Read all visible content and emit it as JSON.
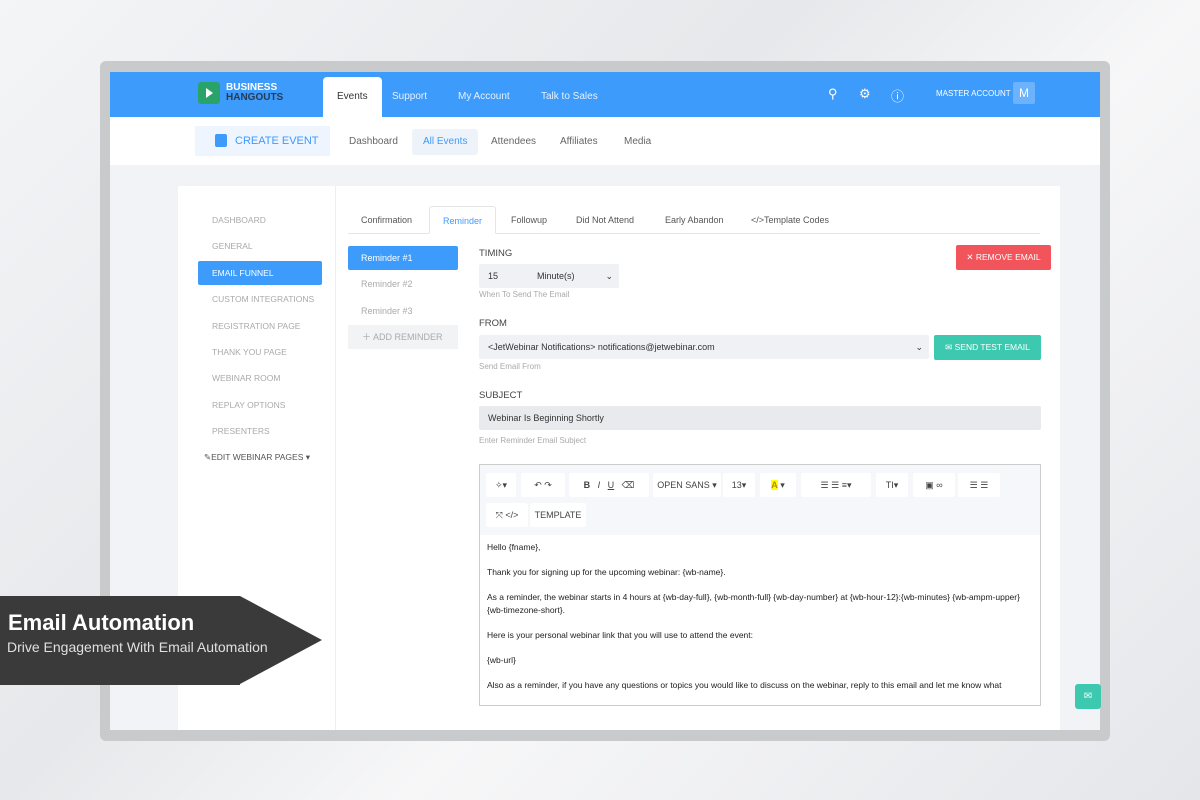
{
  "header": {
    "logo_line1": "BUSINESS",
    "logo_line2": "HANGOUTS",
    "tabs": [
      "Events",
      "Support",
      "My Account",
      "Talk to Sales"
    ],
    "account_label": "MASTER ACCOUNT",
    "avatar": "M"
  },
  "subnav": {
    "create_event": "CREATE EVENT",
    "items": [
      "Dashboard",
      "All Events",
      "Attendees",
      "Affiliates",
      "Media"
    ]
  },
  "sidebar": {
    "items": [
      "DASHBOARD",
      "GENERAL",
      "EMAIL FUNNEL",
      "CUSTOM INTEGRATIONS",
      "REGISTRATION PAGE",
      "THANK YOU PAGE",
      "WEBINAR ROOM",
      "REPLAY OPTIONS",
      "PRESENTERS",
      "EDIT WEBINAR PAGES"
    ]
  },
  "email_tabs": [
    "Confirmation",
    "Reminder",
    "Followup",
    "Did Not Attend",
    "Early Abandon",
    "</>Template Codes"
  ],
  "reminders": [
    "Reminder #1",
    "Reminder #2",
    "Reminder #3"
  ],
  "add_reminder": "ADD REMINDER",
  "timing": {
    "label": "TIMING",
    "value": "15",
    "unit": "Minute(s)",
    "hint": "When To Send The Email"
  },
  "remove_email": "REMOVE EMAIL",
  "from": {
    "label": "FROM",
    "value": "<JetWebinar Notifications> notifications@jetwebinar.com",
    "hint": "Send Email From"
  },
  "send_test": "SEND TEST EMAIL",
  "subject": {
    "label": "SUBJECT",
    "value": "Webinar Is Beginning Shortly",
    "hint": "Enter Reminder Email Subject"
  },
  "toolbar": {
    "font": "OPEN SANS ▾",
    "size": "13▾",
    "template": "TEMPLATE"
  },
  "body": [
    "Hello {fname},",
    "Thank you for signing up for the upcoming webinar: {wb-name}.",
    "As a reminder, the webinar starts in 4 hours at {wb-day-full}, {wb-month-full} {wb-day-number} at {wb-hour-12}:{wb-minutes} {wb-ampm-upper} {wb-timezone-short}.",
    "Here is your personal webinar link that you will use to attend the event:",
    "{wb-url}",
    "Also as a reminder, if you have any questions or topics you would like to discuss on the webinar, reply to this email and let me know what"
  ],
  "banner": {
    "title": "Email Automation",
    "subtitle": "Drive Engagement With Email Automation"
  },
  "colors": {
    "primary": "#3d9bfc",
    "danger": "#f2545b",
    "teal": "#3cc9b0"
  }
}
